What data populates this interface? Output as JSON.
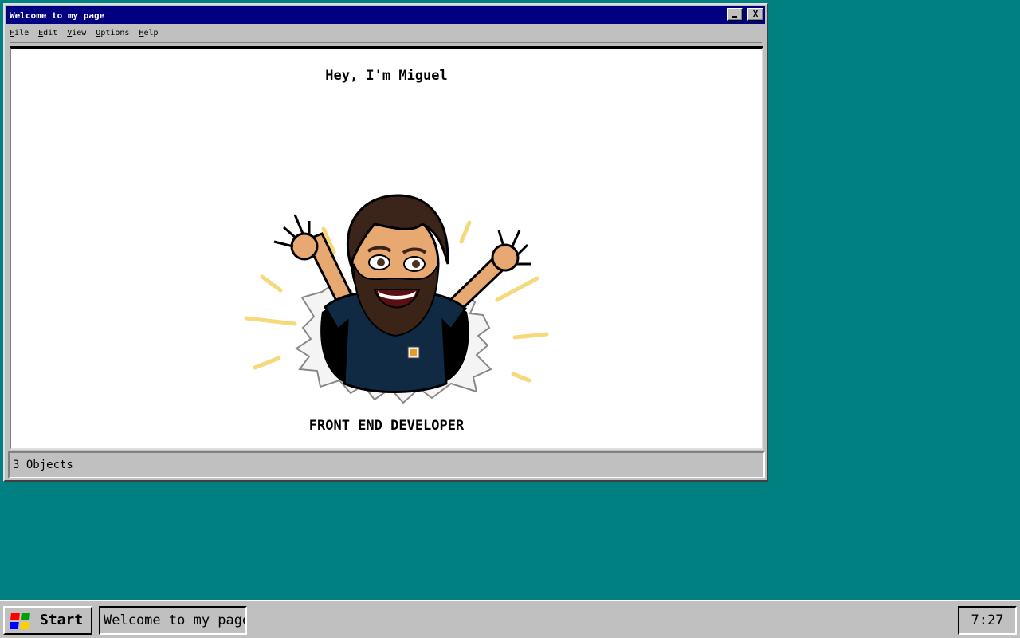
{
  "window": {
    "title": "Welcome to my page",
    "minimize_label": "",
    "close_label": "X"
  },
  "menu": [
    {
      "accel": "F",
      "rest": "ile"
    },
    {
      "accel": "E",
      "rest": "dit"
    },
    {
      "accel": "V",
      "rest": "iew"
    },
    {
      "accel": "O",
      "rest": "ptions"
    },
    {
      "accel": "H",
      "rest": "elp"
    }
  ],
  "content": {
    "heading": "Hey, I'm Miguel",
    "role": "FRONT END DEVELOPER"
  },
  "status": {
    "text": "3 Objects"
  },
  "taskbar": {
    "start_label": "Start",
    "task_label": "Welcome to my page",
    "clock": "7:27 PM"
  },
  "colors": {
    "desktop": "#008080",
    "titlebar": "#000080",
    "chrome": "#c0c0c0"
  }
}
